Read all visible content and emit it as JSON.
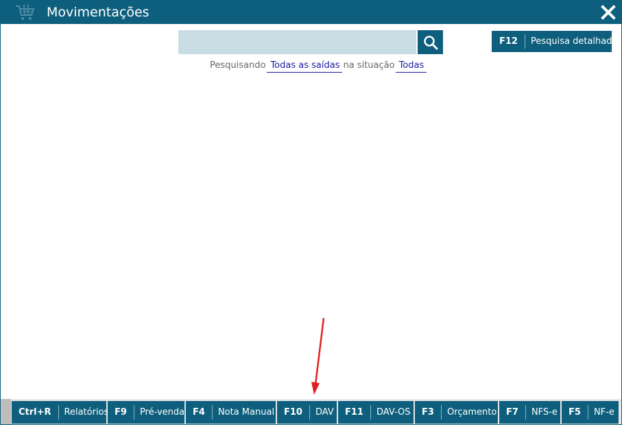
{
  "window": {
    "title": "Movimentações",
    "icons": {
      "app": "shopping-cart-icon",
      "close": "close-icon"
    }
  },
  "search": {
    "value": "",
    "placeholder": "",
    "button_icon": "search-icon",
    "detailed": {
      "key": "F12",
      "label": "Pesquisa detalhada"
    }
  },
  "filter": {
    "prefix": "Pesquisando",
    "scope": "Todas as saídas",
    "middle": "na situação",
    "status": "Todas"
  },
  "shortcuts": [
    {
      "key": "Ctrl+R",
      "label": "Relatórios"
    },
    {
      "key": "F9",
      "label": "Pré-venda"
    },
    {
      "key": "F4",
      "label": "Nota Manual"
    },
    {
      "key": "F10",
      "label": "DAV"
    },
    {
      "key": "F11",
      "label": "DAV-OS"
    },
    {
      "key": "F3",
      "label": "Orçamento"
    },
    {
      "key": "F7",
      "label": "NFS-e"
    },
    {
      "key": "F5",
      "label": "NF-e"
    }
  ],
  "annotation": {
    "icon": "red-arrow-icon",
    "color": "#e02020"
  },
  "colors": {
    "accent": "#0e5f7d",
    "search_bg": "#c8dce4",
    "link": "#1a1aa6"
  }
}
